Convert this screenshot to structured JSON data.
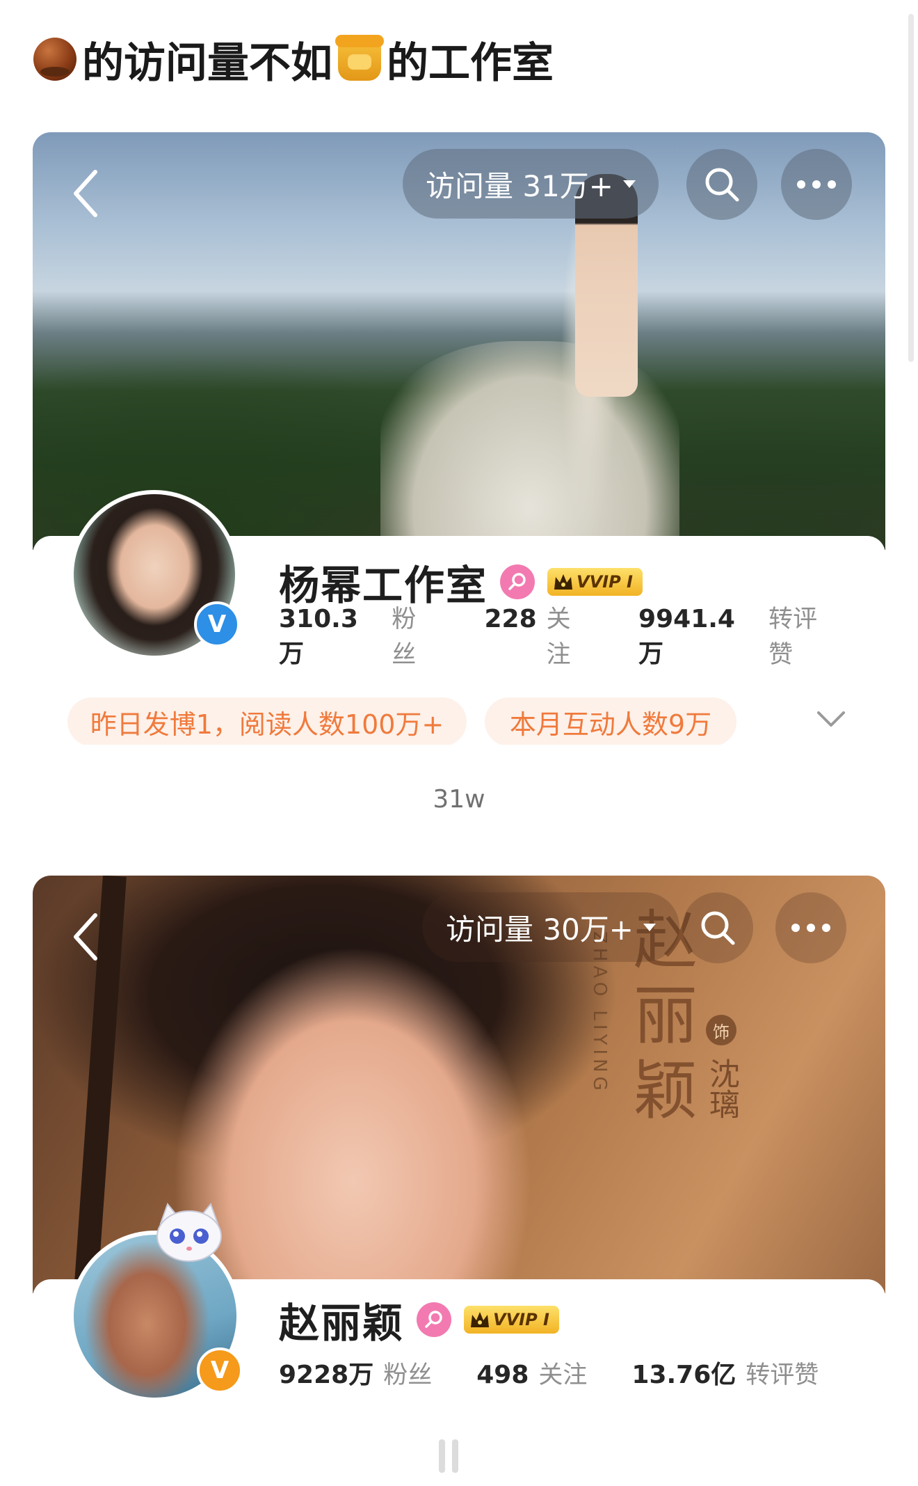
{
  "post": {
    "title_part1": "的访问量不如",
    "title_part2": "的工作室",
    "emoji1": "chestnut-emoji",
    "emoji2": "honey-pot-emoji"
  },
  "profiles": [
    {
      "visits": "访问量 31万+",
      "name": "杨幂工作室",
      "vvip": "VVIP I",
      "verify_badge": "V",
      "verify_color": "#2d8fe6",
      "stats": [
        {
          "value": "310.3万",
          "label": "粉丝"
        },
        {
          "value": "228",
          "label": "关注"
        },
        {
          "value": "9941.4万",
          "label": "转评赞"
        }
      ],
      "hints": [
        "昨日发博1，阅读人数100万+",
        "本月互动人数9万"
      ]
    },
    {
      "visits": "访问量 30万+",
      "name": "赵丽颖",
      "vvip": "VVIP I",
      "verify_badge": "V",
      "verify_color": "#f59a1a",
      "banner_text": {
        "title_chars": [
          "赵",
          "丽",
          "颖"
        ],
        "pinyin": "ZHAO LIYING",
        "seal": "饰",
        "role": "沈璃"
      },
      "stats": [
        {
          "value": "9228万",
          "label": "粉丝"
        },
        {
          "value": "498",
          "label": "关注"
        },
        {
          "value": "13.76亿",
          "label": "转评赞"
        }
      ]
    }
  ],
  "caption": "31w",
  "colors": {
    "accent_orange": "#f07a3c",
    "hint_bg": "#fdf1ea",
    "gender_pink": "#f27ab0",
    "vvip_gold": "#f2b325"
  }
}
